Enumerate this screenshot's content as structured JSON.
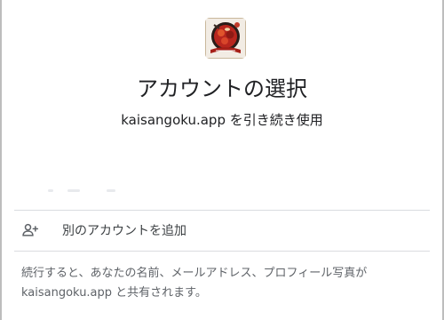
{
  "app": {
    "logo_icon": "restaurant-dish-logo"
  },
  "header": {
    "title": "アカウントの選択",
    "subtitle": "kaisangoku.app を引き続き使用"
  },
  "add_account": {
    "icon": "person-add-icon",
    "label": "別のアカウントを追加"
  },
  "notice": {
    "line1": "続行すると、あなたの名前、メールアドレス、プロフィール写真が",
    "line2": "kaisangoku.app と共有されます。"
  },
  "colors": {
    "text_primary": "#202124",
    "text_secondary": "#5f6368",
    "divider": "#dadce0",
    "logo_red": "#b8261e"
  }
}
